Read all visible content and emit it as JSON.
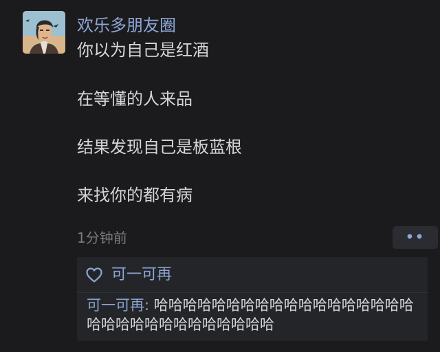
{
  "post": {
    "author": "欢乐多朋友圈",
    "lines": [
      "你以为自己是红酒",
      "在等懂的人来品",
      "结果发现自己是板蓝根",
      "来找你的都有病"
    ],
    "timestamp": "1分钟前",
    "more_icon": "more-dots-icon",
    "more_glyph": "••"
  },
  "likes": {
    "icon": "heart-outline-icon",
    "users": "可一可再"
  },
  "comment": {
    "author": "可一可再",
    "separator": ": ",
    "text": "哈哈哈哈哈哈哈哈哈哈哈哈哈哈哈哈哈哈哈哈哈哈哈哈哈哈哈哈哈哈哈"
  },
  "colors": {
    "background": "#1b1b1d",
    "name_link": "#8ea6d6",
    "body_text": "#d6d6d8",
    "muted_text": "#7b7b80",
    "comment_panel": "#242528"
  }
}
